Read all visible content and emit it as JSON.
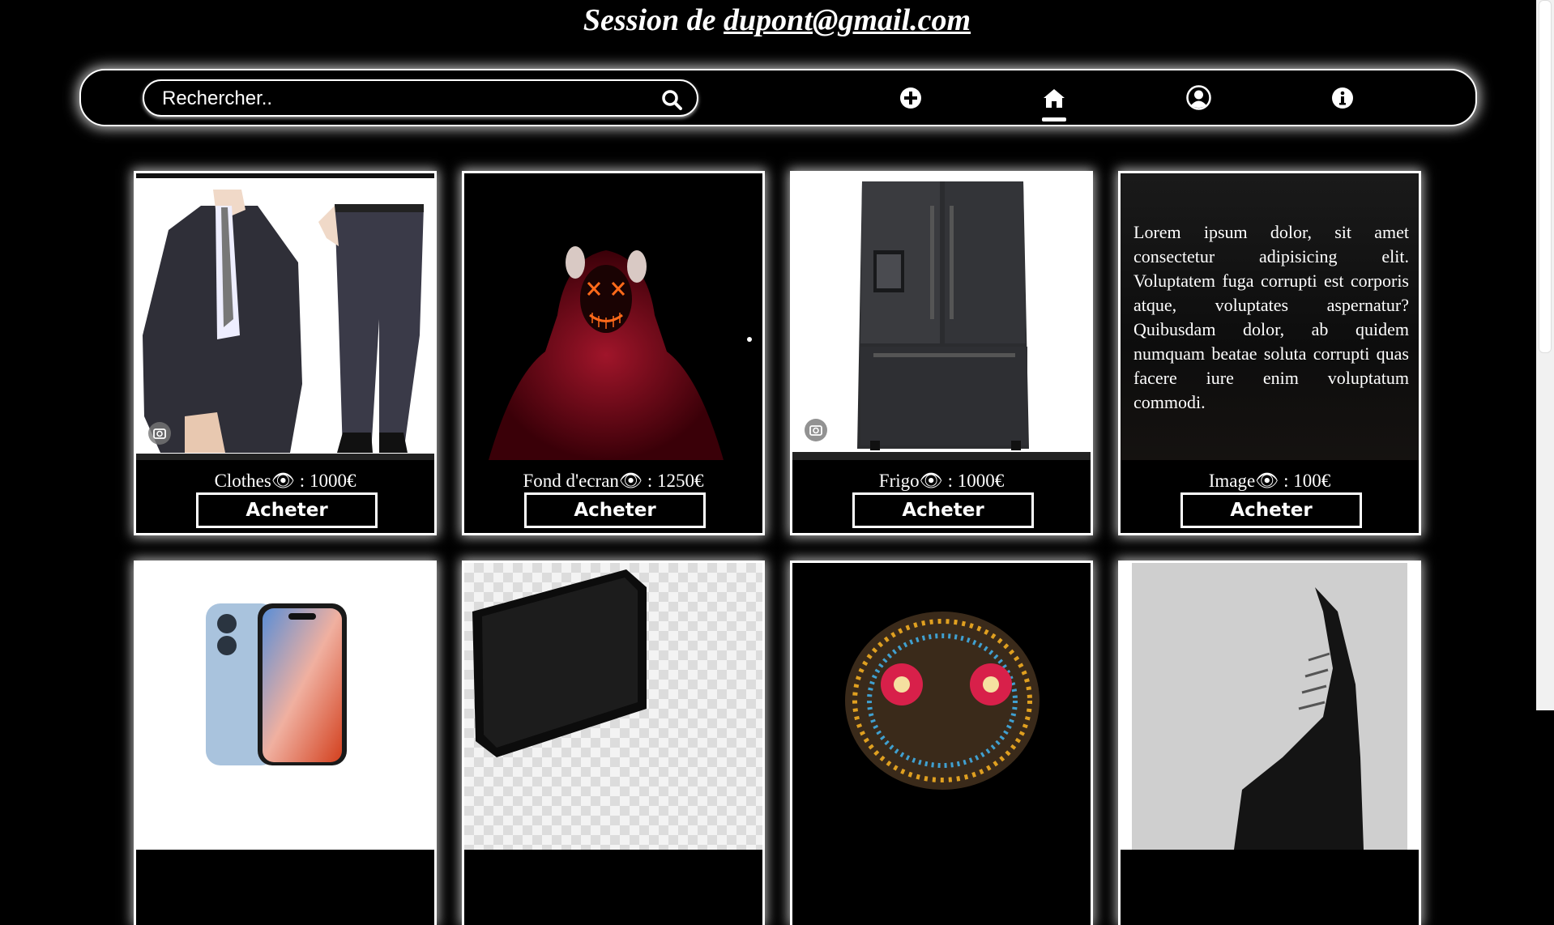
{
  "header": {
    "prefix": "Session de",
    "email": "dupont@gmail.com"
  },
  "search": {
    "placeholder": "Rechercher.."
  },
  "nav": {
    "icons": [
      "plus-circle-icon",
      "home-icon",
      "user-circle-icon",
      "info-circle-icon"
    ],
    "active": "home-icon"
  },
  "buy_label": "Acheter",
  "products": [
    {
      "name": "Clothes",
      "price": "1000€",
      "image": "suit-image"
    },
    {
      "name": "Fond d'ecran",
      "price": "1250€",
      "image": "hooded-figure-image"
    },
    {
      "name": "Frigo",
      "price": "1000€",
      "image": "refrigerator-image"
    },
    {
      "name": "Image",
      "price": "100€",
      "text": "Lorem ipsum dolor, sit amet consectetur adipisicing elit. Voluptatem fuga corrupti est corporis atque, voluptates aspernatur? Quibusdam dolor, ab quidem numquam beatae soluta corrupti quas facere iure enim voluptatum commodi."
    },
    {
      "image": "smartphone-image"
    },
    {
      "image": "laptop-image"
    },
    {
      "image": "decorated-skull-image"
    },
    {
      "image": "leather-shoe-image"
    }
  ]
}
